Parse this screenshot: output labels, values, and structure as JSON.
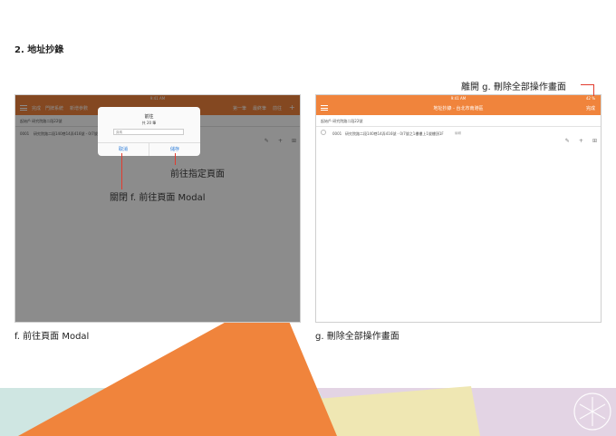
{
  "section_title": "2. 地址抄錄",
  "left_screen": {
    "status_time": "9:41 AM",
    "status_right": "42 %",
    "nav_items": [
      "完成",
      "門牌系統",
      "新增參數"
    ],
    "nav_right_items": [
      "第一筆",
      "最終筆",
      "前往"
    ],
    "nav_plus": "+",
    "header_row": "起始戶 研究院路二段22號",
    "list_row_num": "0001",
    "list_row_text": "研究院路二段140巷14弄416號 - 0/7號",
    "modal": {
      "title": "前往",
      "subtitle": "共 20 筆",
      "input_placeholder": "頁碼",
      "cancel": "取消",
      "confirm": "儲存"
    },
    "caption": "f. 前往頁面 Modal"
  },
  "right_screen": {
    "status_time": "9:41 AM",
    "status_right": "42 %",
    "nav_title": "地址抄錄 - 台北市南港區",
    "nav_done": "完成",
    "header_row": "起始戶 研究院路二段22號",
    "list_row_num": "0001",
    "list_row_text": "研究院路二段140巷14弄416號 - 0/7號之1樓樓上1號樓頂1F",
    "list_row_tag": "編輯",
    "caption": "g. 刪除全部操作畫面"
  },
  "annotations": {
    "leave_g": "離開 g. 刪除全部操作畫面",
    "goto_page": "前往指定頁面",
    "close_modal": "關閉 f. 前往頁面 Modal"
  },
  "icons": {
    "edit": "✎",
    "plus": "+",
    "grid": "⊞",
    "circle": "○"
  },
  "colors": {
    "orange": "#f0843c",
    "red_line": "#e23b2e",
    "overlay": "rgba(0,0,0,0.45)"
  }
}
